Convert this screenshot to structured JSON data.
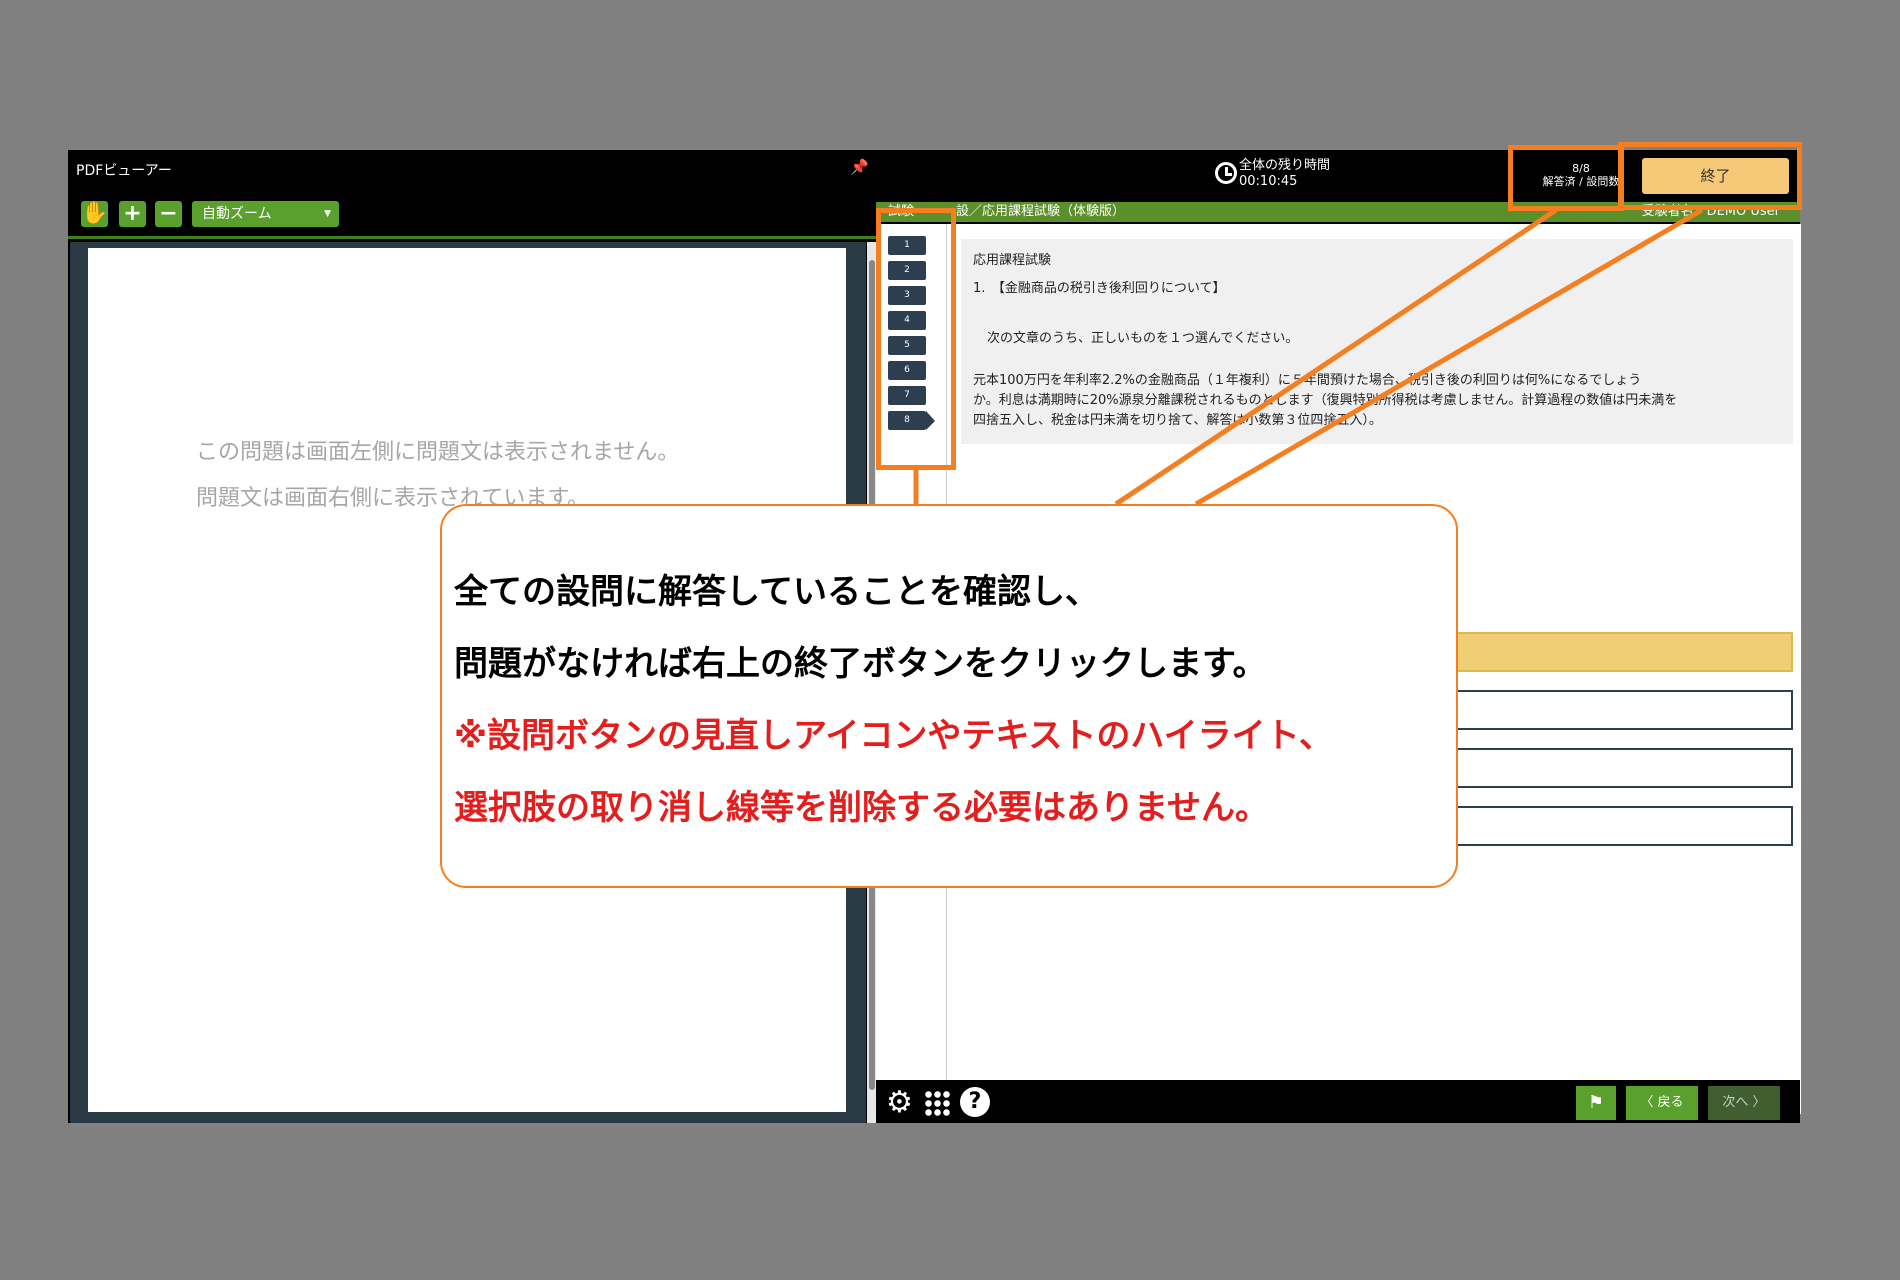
{
  "pdf_viewer": {
    "title": "PDFビューアー",
    "pin_icon": "pin-icon",
    "zoom_label": "自動ズーム",
    "message_line1": "この問題は画面左側に問題文は表示されません。",
    "message_line2": "問題文は画面右側に表示されています。"
  },
  "header": {
    "timer_label": "全体の残り時間",
    "timer_value": "00:10:45",
    "answered_count": "8/8",
    "answered_label": "解答済 / 設問数",
    "finish_label": "終了"
  },
  "exam_bar": {
    "left_label": "試験",
    "title": "設／応用課程試験（体験版）",
    "user": "受験者名：DEMO User"
  },
  "question_nav": [
    "1",
    "2",
    "3",
    "4",
    "5",
    "6",
    "7",
    "8"
  ],
  "question": {
    "heading": "応用課程試験",
    "number_title": "1.　【金融商品の税引き後利回りについて】",
    "instruction": "次の文章のうち、正しいものを１つ選んでください。",
    "body1": "元本100万円を年利率2.2%の金融商品（１年複利）に５年間預けた場合、税引き後の利回りは何%になるでしょう",
    "body2": "か。利息は満期時に20%源泉分離課税されるものとします（復興特別所得税は考慮しません。計算過程の数値は円未満を",
    "body3": "四捨五入し、税金は円未満を切り捨て、解答は小数第３位四捨五入）。"
  },
  "footer": {
    "back_label": "〈 戻る",
    "next_label": "次へ 〉"
  },
  "callout": {
    "line1": "全ての設問に解答していることを確認し、",
    "line2": "問題がなければ右上の終了ボタンをクリックします。",
    "line3": "※設問ボタンの見直しアイコンやテキストのハイライト、",
    "line4": "選択肢の取り消し線等を削除する必要はありません。"
  },
  "colors": {
    "accent_green": "#5aa02c",
    "highlight_orange": "#f57f20",
    "finish_button": "#f5c978",
    "note_red": "#e41d1d"
  }
}
